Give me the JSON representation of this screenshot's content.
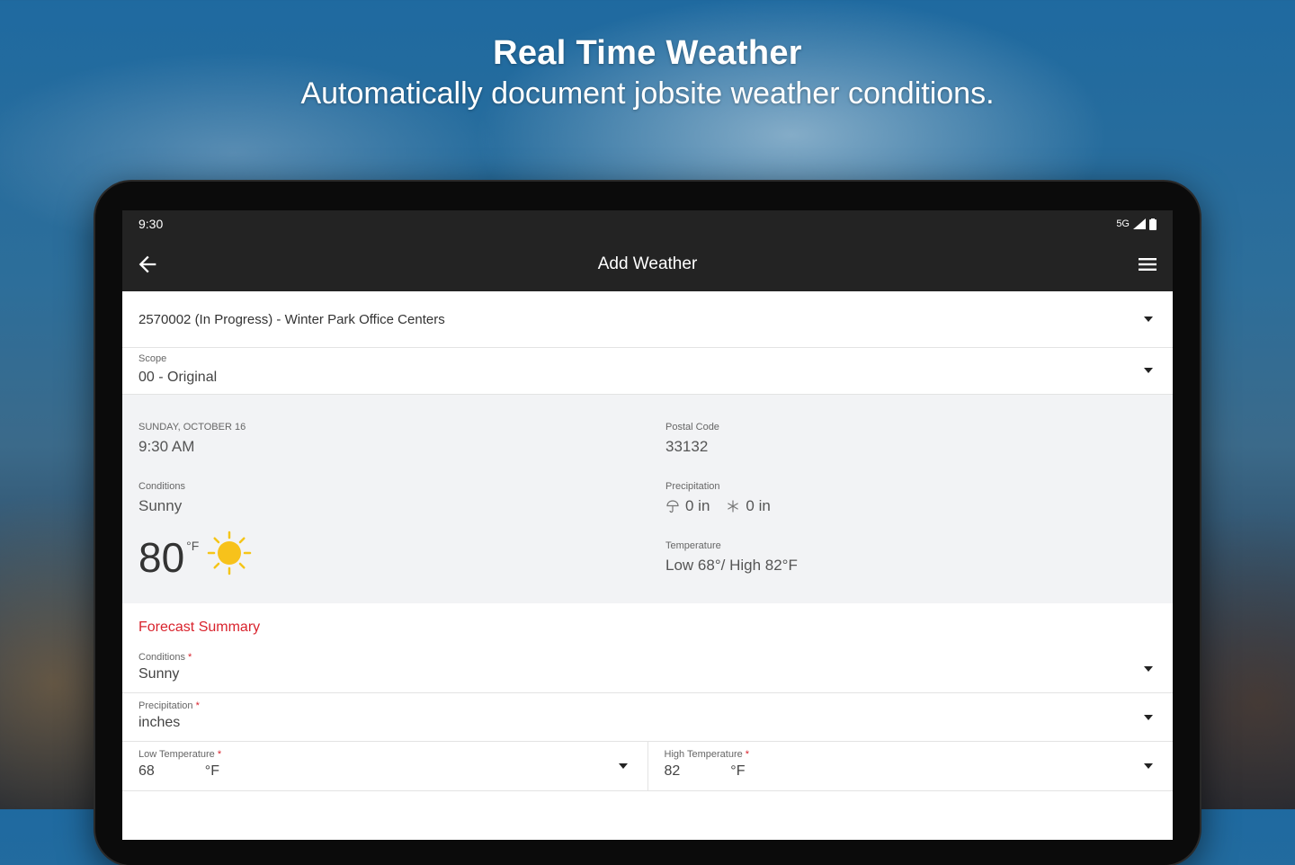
{
  "hero": {
    "title": "Real Time Weather",
    "subtitle": "Automatically document jobsite weather conditions."
  },
  "statusbar": {
    "time": "9:30",
    "signal": "5G"
  },
  "appbar": {
    "title": "Add Weather",
    "back_icon": "arrow-left-icon",
    "menu_icon": "hamburger-menu-icon"
  },
  "project": {
    "value": "2570002 (In Progress) - Winter Park Office Centers"
  },
  "scope": {
    "label": "Scope",
    "value": "00 - Original"
  },
  "current": {
    "date_label": "SUNDAY, OCTOBER 16",
    "time": "9:30 AM",
    "postal_label": "Postal Code",
    "postal": "33132",
    "conditions_label": "Conditions",
    "conditions": "Sunny",
    "precip_label": "Precipitation",
    "rain": "0 in",
    "snow": "0 in",
    "temp": "80",
    "temp_unit": "°F",
    "temperature_label": "Temperature",
    "temperature_range": "Low 68°/ High 82°F"
  },
  "forecast": {
    "title": "Forecast Summary",
    "conditions_label": "Conditions",
    "conditions": "Sunny",
    "precip_label": "Precipitation",
    "precip": "inches",
    "low_label": "Low Temperature",
    "low": "68",
    "low_unit": "°F",
    "high_label": "High Temperature",
    "high": "82",
    "high_unit": "°F",
    "required_mark": "*"
  },
  "colors": {
    "accent": "#d9232d",
    "appbar": "#232323",
    "panel": "#f2f3f5"
  }
}
